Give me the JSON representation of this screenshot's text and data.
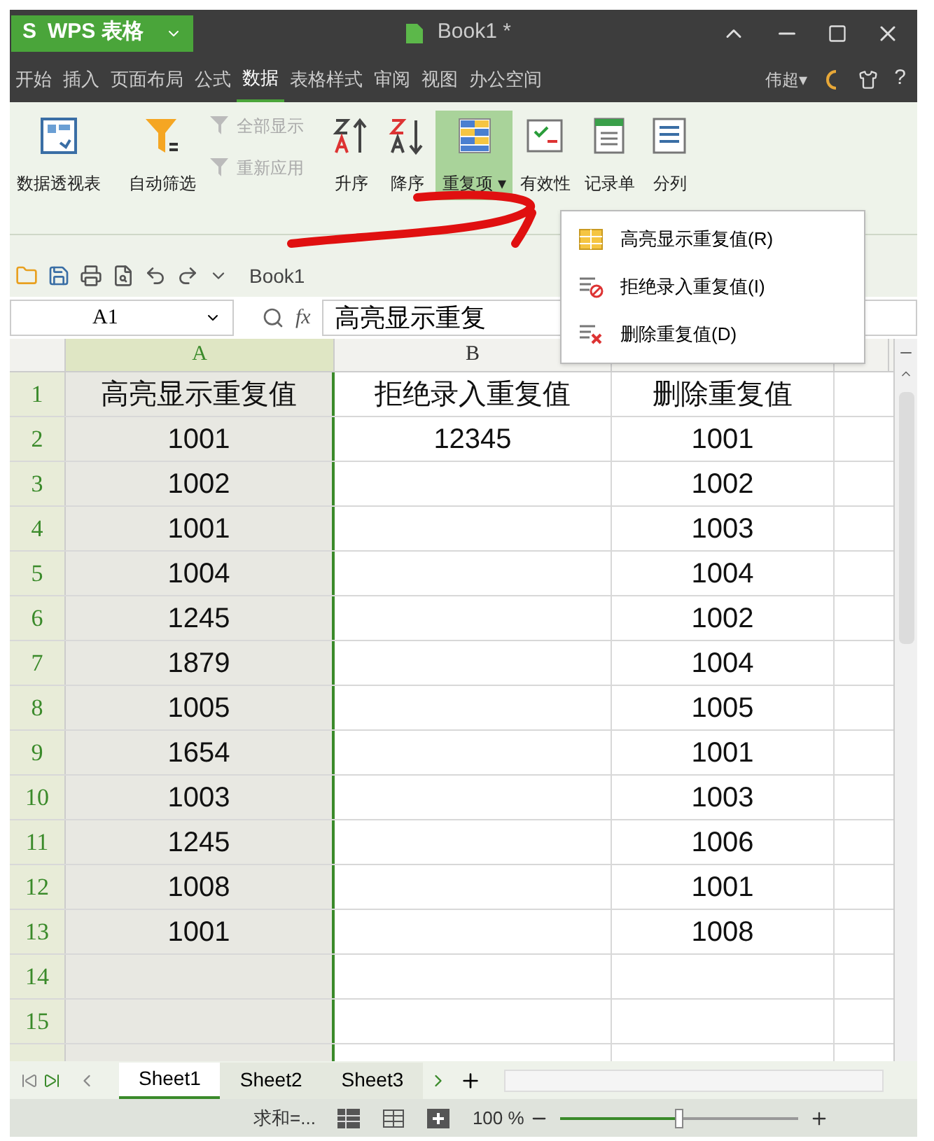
{
  "app_button": {
    "logo": "S",
    "label": "WPS 表格"
  },
  "window": {
    "title": "Book1 *"
  },
  "menu_tabs": [
    {
      "label": "开始",
      "selected": false
    },
    {
      "label": "插入",
      "selected": false
    },
    {
      "label": "页面布局",
      "selected": false
    },
    {
      "label": "公式",
      "selected": false
    },
    {
      "label": "数据",
      "selected": true
    },
    {
      "label": "表格样式",
      "selected": false
    },
    {
      "label": "审阅",
      "selected": false
    },
    {
      "label": "视图",
      "selected": false
    },
    {
      "label": "办公空间",
      "selected": false
    }
  ],
  "user": {
    "name": "伟超",
    "caret": "▾",
    "help": "?"
  },
  "ribbon": [
    {
      "kind": "big",
      "label": "数据透视表",
      "selected": false
    },
    {
      "kind": "big",
      "label": "自动筛选",
      "selected": false
    },
    {
      "kind": "pair",
      "items": [
        {
          "label": "全部显示",
          "disabled": true
        },
        {
          "label": "重新应用",
          "disabled": true
        }
      ]
    },
    {
      "kind": "big",
      "label": "升序",
      "selected": false
    },
    {
      "kind": "big",
      "label": "降序",
      "selected": false
    },
    {
      "kind": "big",
      "label": "重复项",
      "selected": true,
      "caret": "▾"
    },
    {
      "kind": "big",
      "label": "有效性",
      "selected": false
    },
    {
      "kind": "big",
      "label": "记录单",
      "selected": false
    },
    {
      "kind": "big",
      "label": "分列",
      "selected": false
    }
  ],
  "dropdown_menu": [
    {
      "label": "高亮显示重复值(R)"
    },
    {
      "label": "拒绝录入重复值(I)"
    },
    {
      "label": "删除重复值(D)"
    }
  ],
  "quick_toolbar": {
    "document": "Book1"
  },
  "formula_bar": {
    "cell": "A1",
    "fx": "fx",
    "value": "高亮显示重复"
  },
  "columns": [
    {
      "label": "A",
      "selected": true
    },
    {
      "label": "B",
      "selected": false
    },
    {
      "selected": false
    },
    {
      "selected": false
    }
  ],
  "rows": [
    {
      "n": "1",
      "cells": [
        "高亮显示重复值",
        "拒绝录入重复值",
        "删除重复值"
      ]
    },
    {
      "n": "2",
      "cells": [
        "1001",
        "12345",
        "1001"
      ]
    },
    {
      "n": "3",
      "cells": [
        "1002",
        "",
        "1002"
      ]
    },
    {
      "n": "4",
      "cells": [
        "1001",
        "",
        "1003"
      ]
    },
    {
      "n": "5",
      "cells": [
        "1004",
        "",
        "1004"
      ]
    },
    {
      "n": "6",
      "cells": [
        "1245",
        "",
        "1002"
      ]
    },
    {
      "n": "7",
      "cells": [
        "1879",
        "",
        "1004"
      ]
    },
    {
      "n": "8",
      "cells": [
        "1005",
        "",
        "1005"
      ]
    },
    {
      "n": "9",
      "cells": [
        "1654",
        "",
        "1001"
      ]
    },
    {
      "n": "10",
      "cells": [
        "1003",
        "",
        "1003"
      ]
    },
    {
      "n": "11",
      "cells": [
        "1245",
        "",
        "1006"
      ]
    },
    {
      "n": "12",
      "cells": [
        "1008",
        "",
        "1001"
      ]
    },
    {
      "n": "13",
      "cells": [
        "1001",
        "",
        "1008"
      ]
    },
    {
      "n": "14",
      "cells": [
        "",
        "",
        ""
      ]
    },
    {
      "n": "15",
      "cells": [
        "",
        "",
        ""
      ]
    },
    {
      "cells": [
        "",
        "",
        ""
      ]
    }
  ],
  "sheet_tabs": [
    {
      "label": "Sheet1",
      "selected": true
    },
    {
      "label": "Sheet2",
      "selected": false
    },
    {
      "label": "Sheet3",
      "selected": false
    }
  ],
  "status_bar": {
    "sum": "求和=...",
    "zoom": "100 %",
    "level": 0.5
  }
}
